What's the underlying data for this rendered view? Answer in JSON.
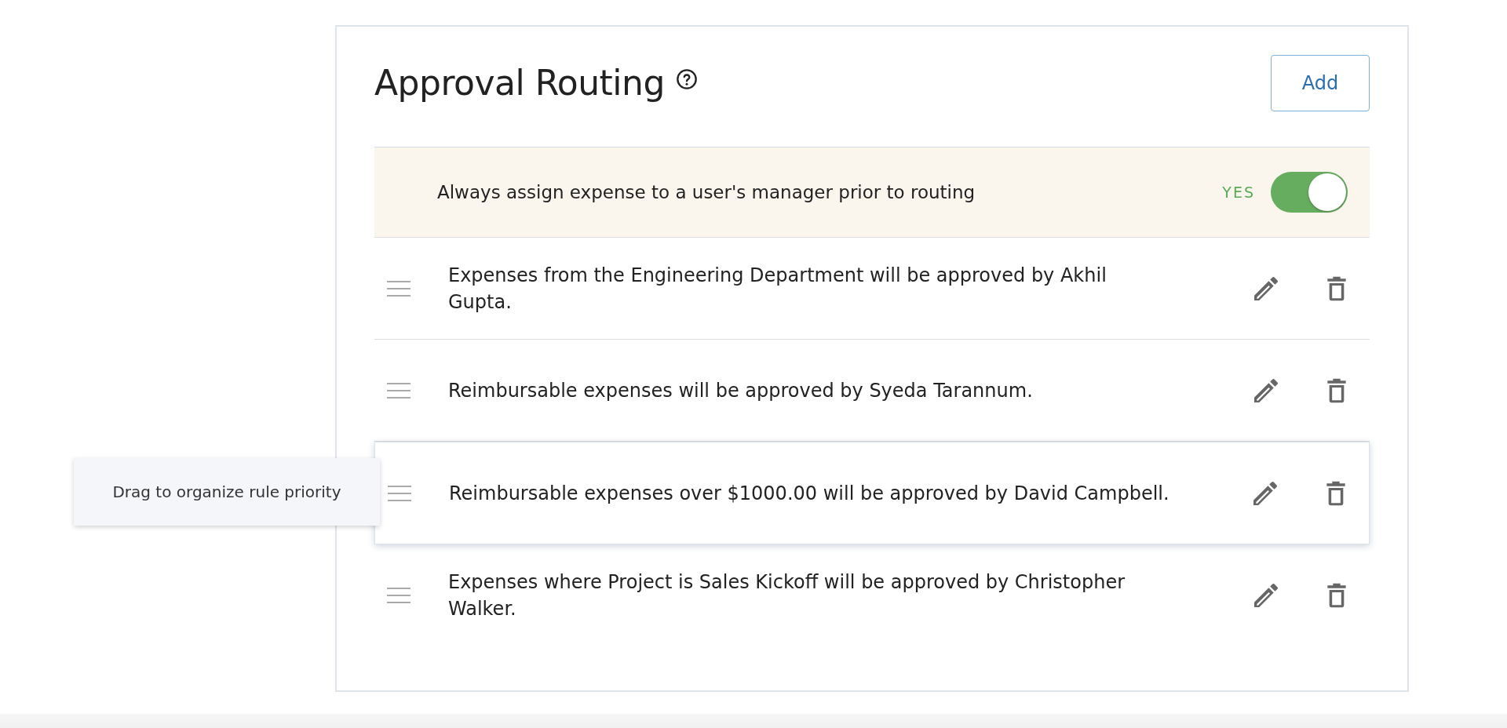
{
  "title": "Approval Routing",
  "add_button": "Add",
  "manager_setting": {
    "label": "Always assign expense to a user's manager prior to routing",
    "state_label": "YES",
    "on": true
  },
  "rules": [
    {
      "text": "Expenses from the Engineering Department will be approved by Akhil Gupta.",
      "hovered": false
    },
    {
      "text": "Reimbursable expenses will be approved by Syeda Tarannum.",
      "hovered": false
    },
    {
      "text": "Reimbursable expenses over $1000.00 will be approved by David Campbell.",
      "hovered": true
    },
    {
      "text": "Expenses where Project is Sales Kickoff will be approved by Christopher Walker.",
      "hovered": false
    }
  ],
  "tooltip": "Drag to organize rule priority"
}
